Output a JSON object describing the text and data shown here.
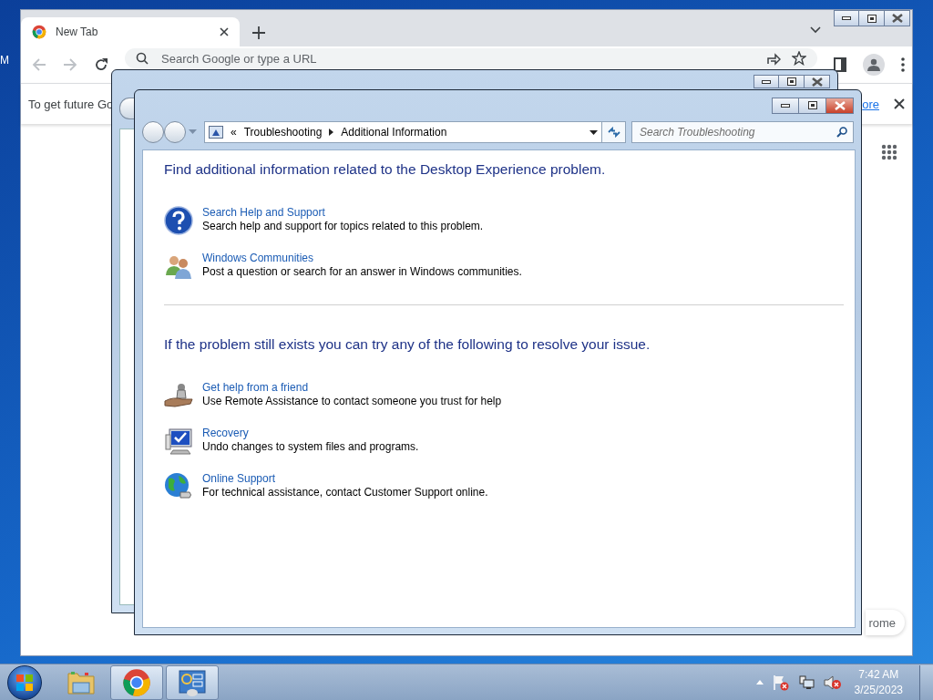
{
  "desktop": {
    "label": "M"
  },
  "browser": {
    "tab": {
      "title": "New Tab"
    },
    "omnibox": {
      "placeholder": "Search Google or type a URL"
    },
    "infobar": {
      "text": "To get future Go",
      "link": "ore"
    },
    "customize_button": "rome"
  },
  "window": {
    "breadcrumb": {
      "overflow": "«",
      "items": [
        "Troubleshooting",
        "Additional Information"
      ]
    },
    "search": {
      "placeholder": "Search Troubleshooting"
    },
    "sections": [
      {
        "heading": "Find additional information related to the Desktop Experience problem.",
        "items": [
          {
            "kind": "help",
            "title": "Search Help and Support",
            "description": "Search help and support for topics related to this problem."
          },
          {
            "kind": "community",
            "title": "Windows Communities",
            "description": "Post a question or search for an answer in Windows communities."
          }
        ]
      },
      {
        "heading": "If the problem still exists you can try any of the following to resolve your issue.",
        "items": [
          {
            "kind": "remote",
            "title": "Get help from a friend",
            "description": "Use Remote Assistance to contact someone you trust for help"
          },
          {
            "kind": "recovery",
            "title": "Recovery",
            "description": "Undo changes to system files and programs."
          },
          {
            "kind": "online",
            "title": "Online Support",
            "description": "For technical assistance, contact Customer Support online."
          }
        ]
      }
    ]
  },
  "taskbar": {
    "apps": [
      {
        "kind": "explorer",
        "running": false
      },
      {
        "kind": "chrome",
        "running": true
      },
      {
        "kind": "control-panel",
        "running": true
      }
    ],
    "clock": {
      "time": "7:42 AM",
      "date": "3/25/2023"
    }
  }
}
